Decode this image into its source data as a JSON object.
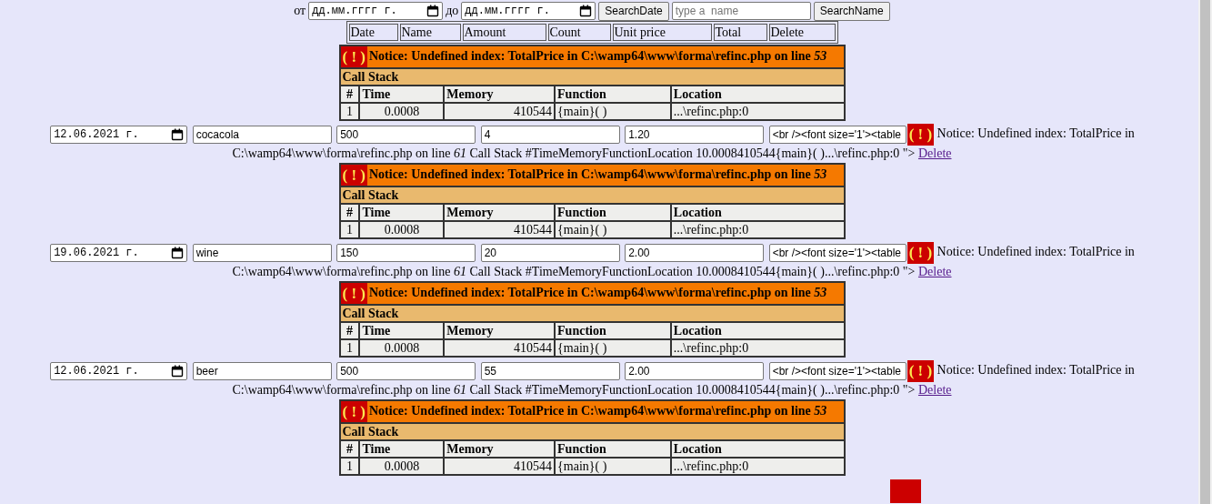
{
  "search": {
    "from_label": "от",
    "from_date": "дд.мм.гггг г.",
    "to_label": "до",
    "to_date": "дд.мм.гггг г.",
    "date_button": "SearchDate",
    "name_placeholder": "type a  name",
    "name_button": "SearchName"
  },
  "columns": [
    "Date",
    "Name",
    "Amount",
    "Count",
    "Unit price",
    "Total",
    "Delete"
  ],
  "blocks": [
    {
      "kind": "notice",
      "icon": "( ! )",
      "message": "Notice: Undefined index: TotalPrice in C:\\wamp64\\www\\forma\\refinc.php on line *53*",
      "stack_title": "Call Stack",
      "headers": [
        "#",
        "Time",
        "Memory",
        "Function",
        "Location"
      ],
      "rows": [
        [
          "1",
          "0.0008",
          "410544",
          "{main}( )",
          "...\\refinc.php:0"
        ]
      ]
    },
    {
      "kind": "record",
      "date": "12.06.2021 г.",
      "name": "cocacola",
      "amount": "500",
      "count": "4",
      "price": "1.20",
      "total": "<br /><font size='1'><table",
      "icon": "( ! )",
      "notice": "Notice: Undefined index: TotalPrice in",
      "trace": "C:\\wamp64\\www\\forma\\refinc.php on line *61* Call Stack #TimeMemoryFunctionLocation 10.0008410544{main}( )...\\refinc.php:0 \">",
      "link": "Delete"
    },
    {
      "kind": "notice",
      "icon": "( ! )",
      "message": "Notice: Undefined index: TotalPrice in C:\\wamp64\\www\\forma\\refinc.php on line *53*",
      "stack_title": "Call Stack",
      "headers": [
        "#",
        "Time",
        "Memory",
        "Function",
        "Location"
      ],
      "rows": [
        [
          "1",
          "0.0008",
          "410544",
          "{main}( )",
          "...\\refinc.php:0"
        ]
      ]
    },
    {
      "kind": "record",
      "date": "19.06.2021 г.",
      "name": "wine",
      "amount": "150",
      "count": "20",
      "price": "2.00",
      "total": "<br /><font size='1'><table",
      "icon": "( ! )",
      "notice": "Notice: Undefined index: TotalPrice in",
      "trace": "C:\\wamp64\\www\\forma\\refinc.php on line *61* Call Stack #TimeMemoryFunctionLocation 10.0008410544{main}( )...\\refinc.php:0 \">",
      "link": "Delete"
    },
    {
      "kind": "notice",
      "icon": "( ! )",
      "message": "Notice: Undefined index: TotalPrice in C:\\wamp64\\www\\forma\\refinc.php on line *53*",
      "stack_title": "Call Stack",
      "headers": [
        "#",
        "Time",
        "Memory",
        "Function",
        "Location"
      ],
      "rows": [
        [
          "1",
          "0.0008",
          "410544",
          "{main}( )",
          "...\\refinc.php:0"
        ]
      ]
    },
    {
      "kind": "record",
      "date": "12.06.2021 г.",
      "name": "beer",
      "amount": "500",
      "count": "55",
      "price": "2.00",
      "total": "<br /><font size='1'><table",
      "icon": "( ! )",
      "notice": "Notice: Undefined index: TotalPrice in",
      "trace": "C:\\wamp64\\www\\forma\\refinc.php on line *61* Call Stack #TimeMemoryFunctionLocation 10.0008410544{main}( )...\\refinc.php:0 \">",
      "link": "Delete"
    },
    {
      "kind": "notice",
      "icon": "( ! )",
      "message": "Notice: Undefined index: TotalPrice in C:\\wamp64\\www\\forma\\refinc.php on line *53*",
      "stack_title": "Call Stack",
      "headers": [
        "#",
        "Time",
        "Memory",
        "Function",
        "Location"
      ],
      "rows": [
        [
          "1",
          "0.0008",
          "410544",
          "{main}( )",
          "...\\refinc.php:0"
        ]
      ]
    }
  ]
}
